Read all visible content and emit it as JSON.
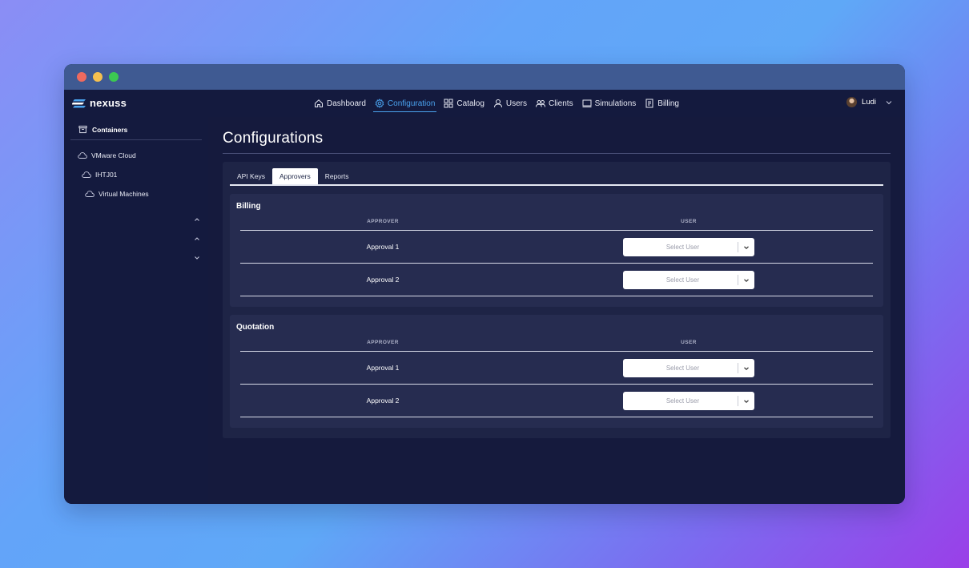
{
  "brand": {
    "name": "nexuss"
  },
  "nav": {
    "items": [
      {
        "label": "Dashboard",
        "icon": "home-icon",
        "active": false
      },
      {
        "label": "Configuration",
        "icon": "gear-icon",
        "active": true
      },
      {
        "label": "Catalog",
        "icon": "grid-icon",
        "active": false
      },
      {
        "label": "Users",
        "icon": "user-icon",
        "active": false
      },
      {
        "label": "Clients",
        "icon": "users-icon",
        "active": false
      },
      {
        "label": "Simulations",
        "icon": "monitor-icon",
        "active": false
      },
      {
        "label": "Billing",
        "icon": "document-icon",
        "active": false
      }
    ],
    "user_name": "Ludi"
  },
  "sidebar": {
    "header": "Containers",
    "tree": [
      {
        "label": "VMware Cloud",
        "icon": "cloud-icon",
        "expanded": true
      },
      {
        "label": "IHTJ01",
        "icon": "cloud-icon",
        "expanded": true
      },
      {
        "label": "Virtual Machines",
        "icon": "cloud-icon",
        "expanded": false
      }
    ]
  },
  "main": {
    "title": "Configurations",
    "tabs": [
      {
        "label": "API Keys",
        "active": false
      },
      {
        "label": "Approvers",
        "active": true
      },
      {
        "label": "Reports",
        "active": false
      }
    ],
    "sections": [
      {
        "title": "Billing",
        "columns": [
          "APPROVER",
          "USER"
        ],
        "rows": [
          {
            "approver": "Approval 1",
            "select_placeholder": "Select User"
          },
          {
            "approver": "Approval 2",
            "select_placeholder": "Select User"
          }
        ]
      },
      {
        "title": "Quotation",
        "columns": [
          "APPROVER",
          "USER"
        ],
        "rows": [
          {
            "approver": "Approval 1",
            "select_placeholder": "Select User"
          },
          {
            "approver": "Approval 2",
            "select_placeholder": "Select User"
          }
        ]
      }
    ]
  },
  "colors": {
    "accent": "#4aa3ef",
    "window_bg": "#151a3d",
    "panel_bg": "#1e2446",
    "section_bg": "#262c50"
  }
}
